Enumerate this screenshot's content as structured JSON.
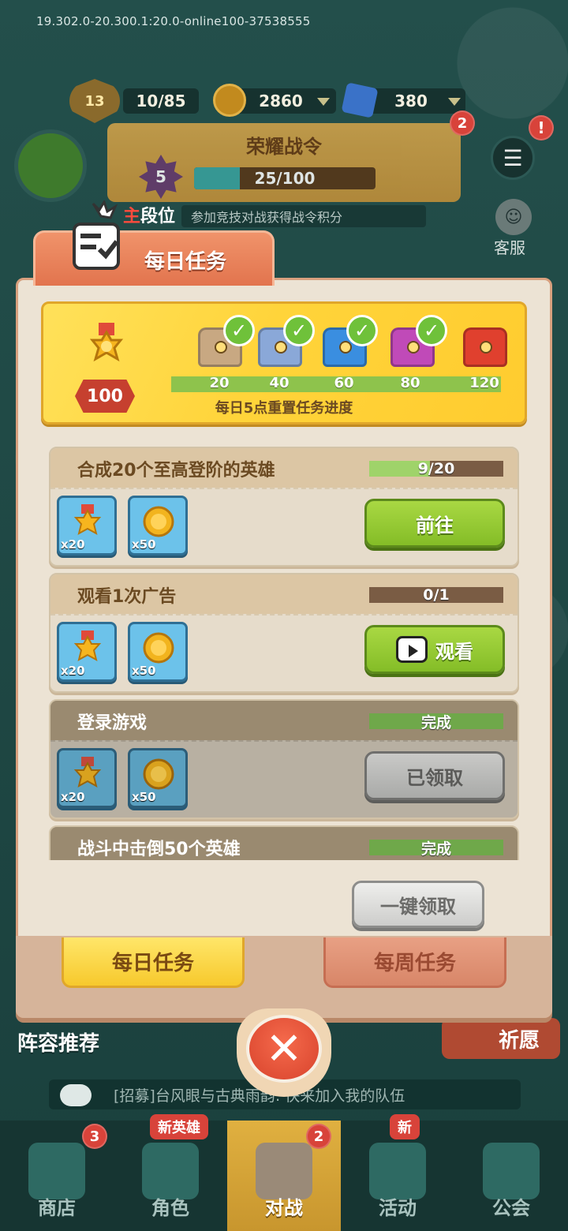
{
  "version": "19.302.0-20.300.1:20.0-online100-37538555",
  "topbar": {
    "level": "13",
    "exp": "10/85",
    "coins": "2860",
    "gems": "380"
  },
  "battle_pass": {
    "title": "荣耀战令",
    "level": "5",
    "progress_text": "25/100",
    "progress": 0.25,
    "badge": "2"
  },
  "side": {
    "cs_label": "客服",
    "rank_prefix": "主",
    "rank_label": "段位",
    "hint": "参加竞技对战获得战令积分"
  },
  "modal": {
    "tab_title": "每日任务",
    "points": "100",
    "milestones": [
      "20",
      "40",
      "60",
      "80",
      "120"
    ],
    "reset_note": "每日5点重置任务进度",
    "tasks": [
      {
        "name": "合成20个至高登阶的英雄",
        "progress_text": "9/20",
        "progress": 0.45,
        "rewards": [
          "x20",
          "x50"
        ],
        "action": "前往"
      },
      {
        "name": "观看1次广告",
        "progress_text": "0/1",
        "progress": 0.0,
        "rewards": [
          "x20",
          "x50"
        ],
        "action": "观看"
      },
      {
        "name": "登录游戏",
        "progress_text": "完成",
        "progress": 1.0,
        "rewards": [
          "x20",
          "x50"
        ],
        "action": "已领取"
      },
      {
        "name": "战斗中击倒50个英雄",
        "progress_text": "完成",
        "progress": 1.0
      }
    ],
    "claim_all": "一键领取",
    "tab_daily": "每日任务",
    "tab_weekly": "每周任务"
  },
  "behind": {
    "lineup": "阵容推荐",
    "wish": "祈愿",
    "chat": "[招募]台风眼与古典雨韵: 快来加入我的队伍"
  },
  "nav": [
    {
      "label": "商店",
      "badge": "3"
    },
    {
      "label": "角色",
      "tag": "新英雄"
    },
    {
      "label": "对战",
      "badge": "2"
    },
    {
      "label": "活动",
      "tag": "新"
    },
    {
      "label": "公会"
    }
  ],
  "colors": {
    "accent_green": "#84bd27",
    "accent_orange": "#e2744e",
    "banner_yellow": "#ffd43a",
    "badge_red": "#d8433a"
  }
}
